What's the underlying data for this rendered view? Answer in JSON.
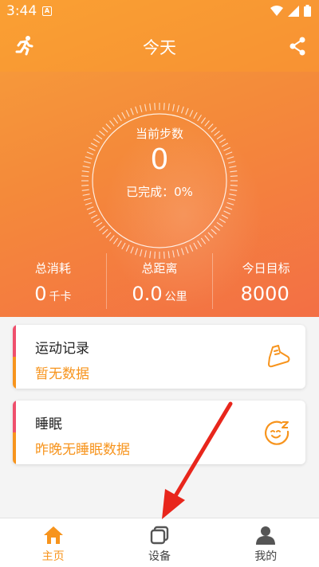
{
  "status_bar": {
    "time": "3:44",
    "app_badge": "A"
  },
  "header": {
    "title": "今天",
    "left_icon": "running-man-icon",
    "right_icon": "share-icon"
  },
  "dial": {
    "label": "当前步数",
    "steps": "0",
    "completion": "已完成：0%"
  },
  "stats": [
    {
      "label": "总消耗",
      "value": "0",
      "unit": "千卡"
    },
    {
      "label": "总距离",
      "value": "0.0",
      "unit": "公里"
    },
    {
      "label": "今日目标",
      "value": "8000",
      "unit": ""
    }
  ],
  "cards": [
    {
      "title": "运动记录",
      "subtitle": "暂无数据",
      "icon": "sneaker-icon"
    },
    {
      "title": "睡眠",
      "subtitle": "昨晚无睡眠数据",
      "icon": "sleep-face-icon"
    }
  ],
  "nav": [
    {
      "label": "主页",
      "icon": "home-icon",
      "active": true
    },
    {
      "label": "设备",
      "icon": "device-icon",
      "active": false
    },
    {
      "label": "我的",
      "icon": "person-icon",
      "active": false
    }
  ],
  "colors": {
    "accent": "#f7941d",
    "hero_start": "#f7a03a",
    "hero_end": "#f36f45",
    "card_bar_top": "#ef4f6c",
    "annotation_arrow": "#e8261c"
  }
}
